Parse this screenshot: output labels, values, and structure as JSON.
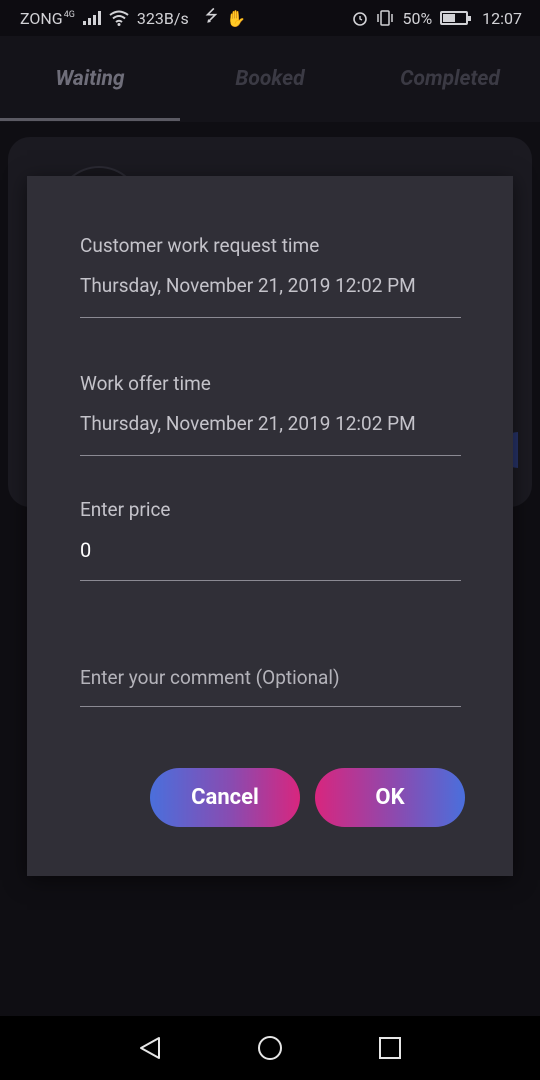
{
  "status_bar": {
    "carrier": "ZONG",
    "network_type": "4G",
    "speed": "323B/s",
    "battery": "50%",
    "time": "12:07"
  },
  "tabs": [
    {
      "label": "Waiting",
      "active": true
    },
    {
      "label": "Booked",
      "active": false
    },
    {
      "label": "Completed",
      "active": false
    }
  ],
  "dialog": {
    "request_time": {
      "label": "Customer work request time",
      "value": "Thursday, November 21, 2019 12:02 PM"
    },
    "offer_time": {
      "label": "Work offer time",
      "value": "Thursday, November 21, 2019 12:02 PM"
    },
    "price": {
      "label": "Enter price",
      "value": "0"
    },
    "comment": {
      "placeholder": "Enter your comment (Optional)"
    },
    "cancel_label": "Cancel",
    "ok_label": "OK"
  },
  "colors": {
    "dialog_bg": "#302f37",
    "page_bg": "#0f0e13",
    "gradient_blue": "#4a6fdc",
    "gradient_pink": "#d8267e"
  }
}
